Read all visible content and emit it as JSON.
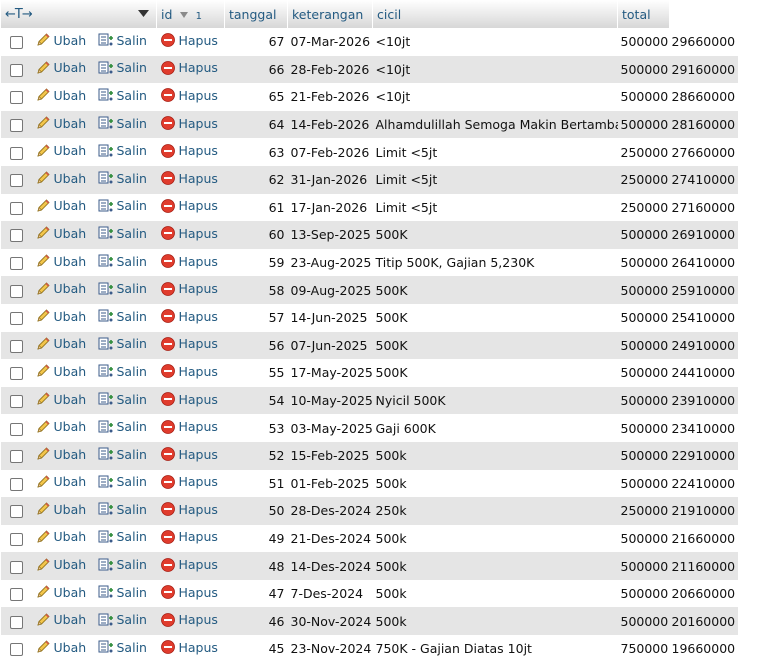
{
  "header": {
    "arrows": "←T→",
    "dropdown_icon": "caret-down-icon",
    "columns": {
      "id": "id",
      "id_sort_order": "1",
      "tanggal": "tanggal",
      "keterangan": "keterangan",
      "cicil": "cicil",
      "total": "total"
    }
  },
  "actions": {
    "edit": "Ubah",
    "copy": "Salin",
    "delete": "Hapus"
  },
  "icons": {
    "edit": "pencil-icon",
    "copy": "copy-icon",
    "delete": "delete-icon"
  },
  "colors": {
    "link": "#235a81",
    "row_alt": "#e5e5e5",
    "delete_red": "#e03c2d"
  },
  "rows": [
    {
      "id": "67",
      "tanggal": "07-Mar-2026",
      "keterangan": "<10jt",
      "cicil": "500000",
      "total": "29660000"
    },
    {
      "id": "66",
      "tanggal": "28-Feb-2026",
      "keterangan": "<10jt",
      "cicil": "500000",
      "total": "29160000"
    },
    {
      "id": "65",
      "tanggal": "21-Feb-2026",
      "keterangan": "<10jt",
      "cicil": "500000",
      "total": "28660000"
    },
    {
      "id": "64",
      "tanggal": "14-Feb-2026",
      "keterangan": "Alhamdulillah Semoga Makin Bertambah",
      "cicil": "500000",
      "total": "28160000"
    },
    {
      "id": "63",
      "tanggal": "07-Feb-2026",
      "keterangan": "Limit <5jt",
      "cicil": "250000",
      "total": "27660000"
    },
    {
      "id": "62",
      "tanggal": "31-Jan-2026",
      "keterangan": "Limit <5jt",
      "cicil": "250000",
      "total": "27410000"
    },
    {
      "id": "61",
      "tanggal": "17-Jan-2026",
      "keterangan": "Limit <5jt",
      "cicil": "250000",
      "total": "27160000"
    },
    {
      "id": "60",
      "tanggal": "13-Sep-2025",
      "keterangan": "500K",
      "cicil": "500000",
      "total": "26910000"
    },
    {
      "id": "59",
      "tanggal": "23-Aug-2025",
      "keterangan": "Titip 500K, Gajian 5,230K",
      "cicil": "500000",
      "total": "26410000"
    },
    {
      "id": "58",
      "tanggal": "09-Aug-2025",
      "keterangan": "500K",
      "cicil": "500000",
      "total": "25910000"
    },
    {
      "id": "57",
      "tanggal": "14-Jun-2025",
      "keterangan": "500K",
      "cicil": "500000",
      "total": "25410000"
    },
    {
      "id": "56",
      "tanggal": "07-Jun-2025",
      "keterangan": "500K",
      "cicil": "500000",
      "total": "24910000"
    },
    {
      "id": "55",
      "tanggal": "17-May-2025",
      "keterangan": "500K",
      "cicil": "500000",
      "total": "24410000"
    },
    {
      "id": "54",
      "tanggal": "10-May-2025",
      "keterangan": "Nyicil 500K",
      "cicil": "500000",
      "total": "23910000"
    },
    {
      "id": "53",
      "tanggal": "03-May-2025",
      "keterangan": "Gaji 600K",
      "cicil": "500000",
      "total": "23410000"
    },
    {
      "id": "52",
      "tanggal": "15-Feb-2025",
      "keterangan": "500k",
      "cicil": "500000",
      "total": "22910000"
    },
    {
      "id": "51",
      "tanggal": "01-Feb-2025",
      "keterangan": "500k",
      "cicil": "500000",
      "total": "22410000"
    },
    {
      "id": "50",
      "tanggal": "28-Des-2024",
      "keterangan": "250k",
      "cicil": "250000",
      "total": "21910000"
    },
    {
      "id": "49",
      "tanggal": "21-Des-2024",
      "keterangan": "500k",
      "cicil": "500000",
      "total": "21660000"
    },
    {
      "id": "48",
      "tanggal": "14-Des-2024",
      "keterangan": "500k",
      "cicil": "500000",
      "total": "21160000"
    },
    {
      "id": "47",
      "tanggal": "7-Des-2024",
      "keterangan": "500k",
      "cicil": "500000",
      "total": "20660000"
    },
    {
      "id": "46",
      "tanggal": "30-Nov-2024",
      "keterangan": "500k",
      "cicil": "500000",
      "total": "20160000"
    },
    {
      "id": "45",
      "tanggal": "23-Nov-2024",
      "keterangan": "750K - Gajian Diatas 10jt",
      "cicil": "750000",
      "total": "19660000"
    }
  ]
}
